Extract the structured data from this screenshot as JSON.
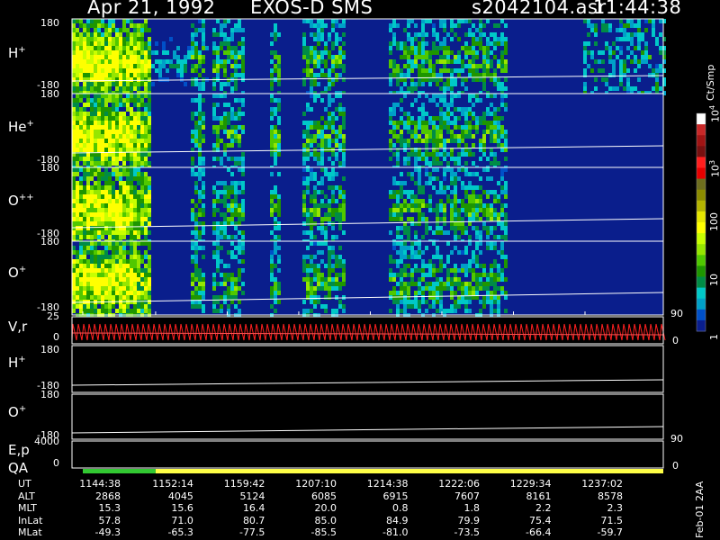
{
  "header": {
    "date": "Apr 21, 1992",
    "instrument": "EXOS-D SMS",
    "file": "s2042104.asr",
    "time": "11:44:38"
  },
  "panels": [
    {
      "id": "h",
      "label": "H",
      "sup": "+",
      "ymax": "180",
      "ymin": "-180"
    },
    {
      "id": "he",
      "label": "He",
      "sup": "+",
      "ymax": "180",
      "ymin": "-180"
    },
    {
      "id": "opp",
      "label": "O",
      "sup": "++",
      "ymax": "180",
      "ymin": "-180"
    },
    {
      "id": "op",
      "label": "O",
      "sup": "+",
      "ymax": "180",
      "ymin": "-180"
    }
  ],
  "vr_panel": {
    "label": "V,r",
    "ymax": "25",
    "ymin": "0",
    "right_max": "90",
    "right_min": "0"
  },
  "h2_panel": {
    "label": "H",
    "sup": "+",
    "ymax": "180",
    "ymin": "-180"
  },
  "o2_panel": {
    "label": "O",
    "sup": "+",
    "ymax": "180",
    "ymin": "-180"
  },
  "ep_panel": {
    "label": "E,p",
    "ymax": "4000",
    "ymin": "0",
    "right_max": "90",
    "right_min": "0"
  },
  "qa_label": "QA",
  "colorbar": {
    "unit": "Ct/Smp",
    "ticks": [
      {
        "base": "10",
        "exp": "4",
        "frac": 0.0
      },
      {
        "base": "10",
        "exp": "3",
        "frac": 0.25
      },
      {
        "base": "100",
        "exp": "",
        "frac": 0.5
      },
      {
        "base": "10",
        "exp": "",
        "frac": 0.75
      },
      {
        "base": "1",
        "exp": "",
        "frac": 1.0
      }
    ],
    "colors": [
      "#ffffff",
      "#c82828",
      "#a01414",
      "#781010",
      "#ff1e1e",
      "#e60000",
      "#6e6e1e",
      "#8c8c00",
      "#b4b400",
      "#e6e600",
      "#ffff00",
      "#c8ff00",
      "#96e600",
      "#50c800",
      "#1e9600",
      "#008c46",
      "#00c8c8",
      "#00a0c8",
      "#0050c8",
      "#0a1e8c"
    ]
  },
  "ephemeris": {
    "rows": [
      {
        "label": "UT",
        "values": [
          "1144:38",
          "1152:14",
          "1159:42",
          "1207:10",
          "1214:38",
          "1222:06",
          "1229:34",
          "1237:02"
        ]
      },
      {
        "label": "ALT",
        "values": [
          "2868",
          "4045",
          "5124",
          "6085",
          "6915",
          "7607",
          "8161",
          "8578"
        ]
      },
      {
        "label": "MLT",
        "values": [
          "15.3",
          "15.6",
          "16.4",
          "20.0",
          "0.8",
          "1.8",
          "2.2",
          "2.3"
        ]
      },
      {
        "label": "InLat",
        "values": [
          "57.8",
          "71.0",
          "80.7",
          "85.0",
          "84.9",
          "79.9",
          "75.4",
          "71.5"
        ]
      },
      {
        "label": "MLat",
        "values": [
          "-49.3",
          "-65.3",
          "-77.5",
          "-85.5",
          "-81.0",
          "-73.5",
          "-66.4",
          "-59.7"
        ]
      }
    ]
  },
  "footer_text": "Feb-01 2AA",
  "chart_data": {
    "type": "heatmap",
    "title": "Apr 21, 1992   EXOS-D SMS",
    "x_ticks": [
      "1144:38",
      "1152:14",
      "1159:42",
      "1207:10",
      "1214:38",
      "1222:06",
      "1229:34",
      "1237:02"
    ],
    "panels": [
      "H+",
      "He+",
      "O++",
      "O+"
    ],
    "ylim": [
      -180,
      180
    ],
    "colorbar_label": "Ct/Smp",
    "colorbar_range": [
      1,
      10000
    ],
    "log_scale": true,
    "qa": [
      {
        "from": "1144:38",
        "to": "1152:14",
        "color": "#32c832"
      },
      {
        "from": "1152:14",
        "to": "1237:02",
        "color": "#ffff46"
      }
    ]
  }
}
